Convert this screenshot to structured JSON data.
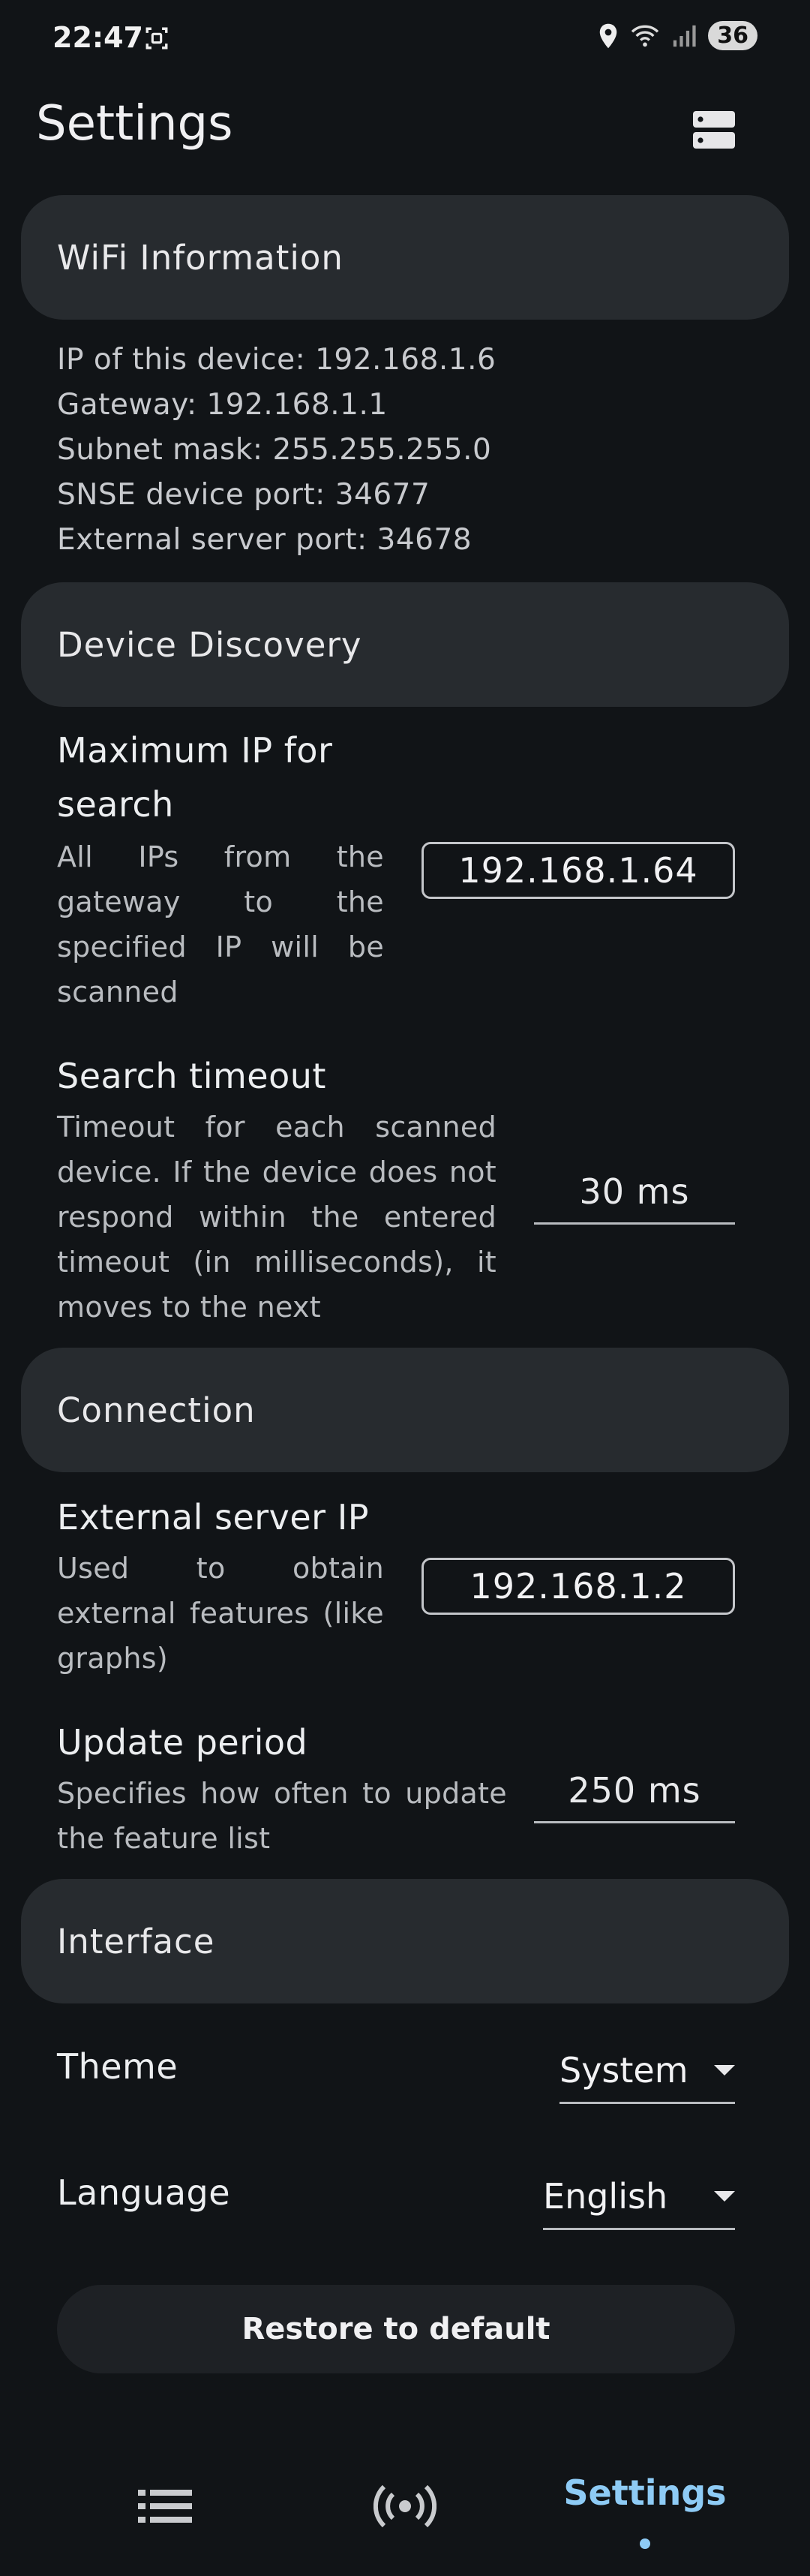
{
  "status_bar": {
    "time": "22:47",
    "battery": "36"
  },
  "header": {
    "title": "Settings"
  },
  "sections": {
    "wifi": {
      "title": "WiFi Information",
      "lines": [
        "IP of this device: 192.168.1.6",
        "Gateway: 192.168.1.1",
        "Subnet mask: 255.255.255.0",
        "SNSE device port: 34677",
        "External server port: 34678"
      ]
    },
    "discovery": {
      "title": "Device Discovery",
      "max_ip": {
        "title": "Maximum IP for search",
        "description": "All IPs from the gateway to the specified IP will be scanned",
        "value": "192.168.1.64"
      },
      "timeout": {
        "title": "Search timeout",
        "description": "Timeout for each scanned device. If the device does not respond within the entered timeout (in milliseconds), it moves to the next",
        "value": "30 ms"
      }
    },
    "connection": {
      "title": "Connection",
      "server_ip": {
        "title": "External server IP",
        "description": "Used to obtain external features (like graphs)",
        "value": "192.168.1.2"
      },
      "update_period": {
        "title": "Update period",
        "description": "Specifies how often to update the feature list",
        "value": "250 ms"
      }
    },
    "interface": {
      "title": "Interface",
      "theme": {
        "label": "Theme",
        "value": "System"
      },
      "language": {
        "label": "Language",
        "value": "English"
      }
    }
  },
  "restore_button": "Restore to default",
  "bottom_nav": {
    "items": [
      {
        "icon": "list-icon"
      },
      {
        "icon": "broadcast-icon"
      },
      {
        "label": "Settings",
        "active": true
      }
    ],
    "accent_color": "#8ecbf5"
  }
}
